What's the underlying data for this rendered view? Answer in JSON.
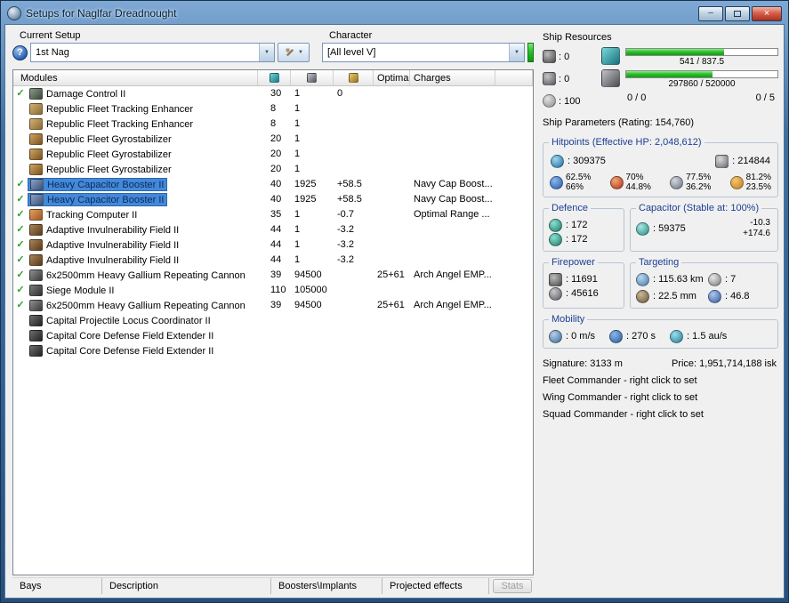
{
  "icons": {
    "help": "?",
    "dropdown": "▼",
    "check": "✓",
    "minimize": "–",
    "close": "×"
  },
  "window": {
    "title": "Setups for Naglfar Dreadnought"
  },
  "setup": {
    "label": "Current Setup",
    "value": "1st Nag"
  },
  "character": {
    "label": "Character",
    "value": "[All level V]"
  },
  "modules_table": {
    "col_modules": "Modules",
    "col_optimal": "Optimal",
    "col_charges": "Charges",
    "rows": [
      {
        "checked": true,
        "selected": false,
        "icon": "dc",
        "name": "Damage Control II",
        "cpu": "30",
        "pg": "1",
        "cap": "0",
        "optimal": "",
        "charges": ""
      },
      {
        "checked": false,
        "selected": false,
        "icon": "te",
        "name": "Republic Fleet Tracking Enhancer",
        "cpu": "8",
        "pg": "1",
        "cap": "",
        "optimal": "",
        "charges": ""
      },
      {
        "checked": false,
        "selected": false,
        "icon": "te",
        "name": "Republic Fleet Tracking Enhancer",
        "cpu": "8",
        "pg": "1",
        "cap": "",
        "optimal": "",
        "charges": ""
      },
      {
        "checked": false,
        "selected": false,
        "icon": "gyro",
        "name": "Republic Fleet Gyrostabilizer",
        "cpu": "20",
        "pg": "1",
        "cap": "",
        "optimal": "",
        "charges": ""
      },
      {
        "checked": false,
        "selected": false,
        "icon": "gyro",
        "name": "Republic Fleet Gyrostabilizer",
        "cpu": "20",
        "pg": "1",
        "cap": "",
        "optimal": "",
        "charges": ""
      },
      {
        "checked": false,
        "selected": false,
        "icon": "gyro",
        "name": "Republic Fleet Gyrostabilizer",
        "cpu": "20",
        "pg": "1",
        "cap": "",
        "optimal": "",
        "charges": ""
      },
      {
        "checked": true,
        "selected": true,
        "icon": "cb",
        "name": "Heavy Capacitor Booster II",
        "cpu": "40",
        "pg": "1925",
        "cap": "+58.5",
        "optimal": "",
        "charges": "Navy Cap Boost..."
      },
      {
        "checked": true,
        "selected": true,
        "icon": "cb",
        "name": "Heavy Capacitor Booster II",
        "cpu": "40",
        "pg": "1925",
        "cap": "+58.5",
        "optimal": "",
        "charges": "Navy Cap Boost..."
      },
      {
        "checked": true,
        "selected": false,
        "icon": "tc",
        "name": "Tracking Computer II",
        "cpu": "35",
        "pg": "1",
        "cap": "-0.7",
        "optimal": "",
        "charges": "Optimal Range ..."
      },
      {
        "checked": true,
        "selected": false,
        "icon": "inv",
        "name": "Adaptive Invulnerability Field II",
        "cpu": "44",
        "pg": "1",
        "cap": "-3.2",
        "optimal": "",
        "charges": ""
      },
      {
        "checked": true,
        "selected": false,
        "icon": "inv",
        "name": "Adaptive Invulnerability Field II",
        "cpu": "44",
        "pg": "1",
        "cap": "-3.2",
        "optimal": "",
        "charges": ""
      },
      {
        "checked": true,
        "selected": false,
        "icon": "inv",
        "name": "Adaptive Invulnerability Field II",
        "cpu": "44",
        "pg": "1",
        "cap": "-3.2",
        "optimal": "",
        "charges": ""
      },
      {
        "checked": true,
        "selected": false,
        "icon": "gun",
        "name": "6x2500mm Heavy Gallium Repeating Cannon",
        "cpu": "39",
        "pg": "94500",
        "cap": "",
        "optimal": "25+61",
        "charges": "Arch Angel EMP..."
      },
      {
        "checked": true,
        "selected": false,
        "icon": "siege",
        "name": "Siege Module II",
        "cpu": "110",
        "pg": "105000",
        "cap": "",
        "optimal": "",
        "charges": ""
      },
      {
        "checked": true,
        "selected": false,
        "icon": "gun",
        "name": "6x2500mm Heavy Gallium Repeating Cannon",
        "cpu": "39",
        "pg": "94500",
        "cap": "",
        "optimal": "25+61",
        "charges": "Arch Angel EMP..."
      },
      {
        "checked": false,
        "selected": false,
        "icon": "rig",
        "name": "Capital Projectile Locus Coordinator II",
        "cpu": "",
        "pg": "",
        "cap": "",
        "optimal": "",
        "charges": ""
      },
      {
        "checked": false,
        "selected": false,
        "icon": "rig",
        "name": "Capital Core Defense Field Extender II",
        "cpu": "",
        "pg": "",
        "cap": "",
        "optimal": "",
        "charges": ""
      },
      {
        "checked": false,
        "selected": false,
        "icon": "rig",
        "name": "Capital Core Defense Field Extender II",
        "cpu": "",
        "pg": "",
        "cap": "",
        "optimal": "",
        "charges": ""
      }
    ]
  },
  "tabs": [
    {
      "label": "Bays"
    },
    {
      "label": "Description"
    },
    {
      "label": "Boosters\\Implants"
    },
    {
      "label": "Projected effects"
    }
  ],
  "stats_button": "Stats",
  "ship_resources": {
    "title": "Ship Resources",
    "turrets": ": 0",
    "launchers": ": 0",
    "calibration": ": 100",
    "cpu": {
      "text": "541 / 837.5",
      "pct": 64.6
    },
    "powergrid": {
      "text": "297860 / 520000",
      "pct": 57.3
    },
    "drones": "0 / 0",
    "rigs": "0 / 5",
    "accent_green": "#2cc22c"
  },
  "ship_parameters": {
    "title": "Ship Parameters (Rating: 154,760)",
    "hitpoints": {
      "title": "Hitpoints (Effective HP: 2,048,612)",
      "shield": ": 309375",
      "armor": ": 214844",
      "resists": [
        {
          "top": "62.5%",
          "bottom": "66%"
        },
        {
          "top": "70%",
          "bottom": "44.8%"
        },
        {
          "top": "77.5%",
          "bottom": "36.2%"
        },
        {
          "top": "81.2%",
          "bottom": "23.5%"
        }
      ]
    },
    "defence": {
      "title": "Defence",
      "v1": ": 172",
      "v2": ": 172"
    },
    "capacitor": {
      "title": "Capacitor (Stable at: 100%)",
      "amount": ": 59375",
      "delta1": "-10.3",
      "delta2": "+174.6"
    },
    "firepower": {
      "title": "Firepower",
      "v1": ": 11691",
      "v2": ": 45616"
    },
    "targeting": {
      "title": "Targeting",
      "range": ": 115.63 km",
      "max_targets": ": 7",
      "scan_res": ": 22.5 mm",
      "sensor": ": 46.8"
    },
    "mobility": {
      "title": "Mobility",
      "speed": ": 0 m/s",
      "align": ": 270 s",
      "warp": ": 1.5 au/s"
    },
    "signature": "Signature: 3133 m",
    "price": "Price: 1,951,714,188 isk",
    "fleet_commander": "Fleet Commander - right click to set",
    "wing_commander": "Wing Commander - right click to set",
    "squad_commander": "Squad Commander - right click to set"
  }
}
